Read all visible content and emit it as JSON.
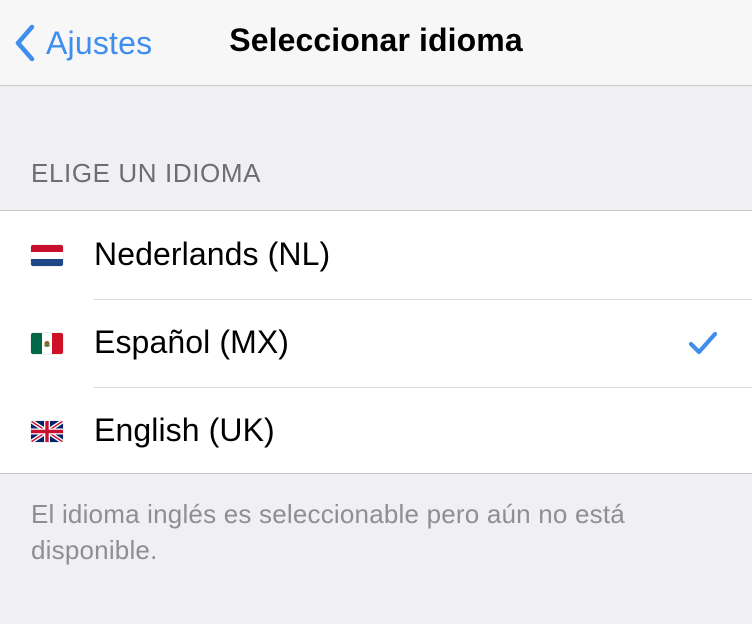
{
  "nav": {
    "back_label": "Ajustes",
    "title": "Seleccionar idioma"
  },
  "section_header": "ELIGE UN IDIOMA",
  "languages": [
    {
      "label": "Nederlands (NL)",
      "flag": "netherlands-flag-icon",
      "selected": false
    },
    {
      "label": "Español (MX)",
      "flag": "mexico-flag-icon",
      "selected": true
    },
    {
      "label": "English (UK)",
      "flag": "uk-flag-icon",
      "selected": false
    }
  ],
  "footer_note": "El idioma inglés es seleccionable pero aún no está disponible.",
  "colors": {
    "accent": "#3f8ded",
    "background": "#efeff4",
    "secondary_text": "#6d6d72"
  }
}
